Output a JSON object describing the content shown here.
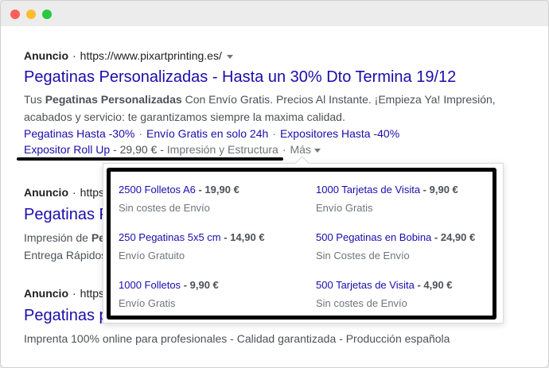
{
  "ads": [
    {
      "label": "Anuncio",
      "url": "https://www.pixartprinting.es/",
      "title": "Pegatinas Personalizadas - Hasta un 30% Dto Termina 19/12",
      "desc1_pre": "Tus ",
      "desc1_bold": "Pegatinas Personalizadas",
      "desc1_post": " Con Envío Gratis. Precios Al Instante. ¡Empieza Ya! Impresión,",
      "desc2": "acabados y servicio: te garantizamos siempre la maxima calidad.",
      "sitelinks": [
        "Pegatinas Hasta -30%",
        "Envío Gratis en solo 24h",
        "Expositores Hasta -40%"
      ],
      "expositor_link": "Expositor Roll Up",
      "expositor_price": "29,90 €",
      "expositor_desc": "Impresión y Estructura",
      "mas_label": "Más"
    },
    {
      "label": "Anuncio",
      "url_partial": "https",
      "title_partial": "Pegatinas P",
      "desc1_pre": "Impresión de ",
      "desc1_bold": "Pe",
      "desc2": "Entrega Rápidos"
    },
    {
      "label": "Anuncio",
      "url_partial": "https",
      "title_partial": "Pegatinas p",
      "desc": "Imprenta 100% online para profesionales - Calidad garantizada - Producción española"
    }
  ],
  "popup": {
    "items": [
      {
        "link": "2500 Folletos A6",
        "price": "19,90 €",
        "sub": "Sin costes de Envío"
      },
      {
        "link": "1000 Tarjetas de Visita",
        "price": "9,90 €",
        "sub": "Envío Gratis"
      },
      {
        "link": "250 Pegatinas 5x5 cm",
        "price": "14,90 €",
        "sub": "Envío Gratuito"
      },
      {
        "link": "500 Pegatinas en Bobina",
        "price": "24,90 €",
        "sub": "Sin Costes de Envío"
      },
      {
        "link": "1000 Folletos",
        "price": "9,90 €",
        "sub": "Envío Gratis"
      },
      {
        "link": "500 Tarjetas de Visita",
        "price": "4,90 €",
        "sub": "Sin costes de Envío"
      }
    ]
  },
  "colors": {
    "link": "#1a0dab",
    "text": "#4d5156",
    "muted": "#70757a"
  }
}
